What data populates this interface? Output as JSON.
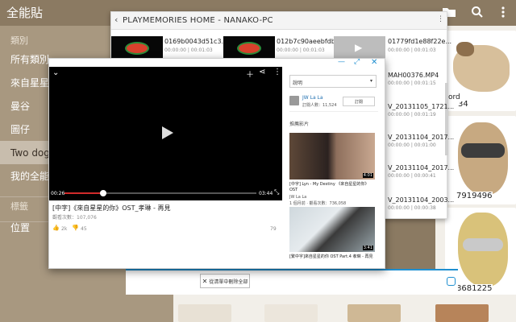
{
  "app": {
    "title": "全能貼"
  },
  "sidebar": {
    "section1": "類別",
    "items": [
      {
        "label": "所有類別"
      },
      {
        "label": "來自星星的"
      },
      {
        "label": "曼谷"
      },
      {
        "label": "圖仔"
      },
      {
        "label": "Two dogs"
      },
      {
        "label": "我的全能貼"
      }
    ],
    "section2": "標籤",
    "section3": "位置"
  },
  "playmemories": {
    "title": "PLAYMEMORIES HOME - NANAKO-PC",
    "top_items": [
      {
        "name": "0169b0043d51c3...",
        "meta": "00:00:00 | 00:01:03"
      },
      {
        "name": "012b7c90aeebfdb...",
        "meta": "00:00:00 | 00:01:03"
      },
      {
        "name": "01779fd1e88f22e...",
        "meta": "00:00:00 | 00:01:03"
      }
    ],
    "list_items": [
      {
        "name": "MAH00376.MP4",
        "meta": "00:00:00 | 00:01:15"
      },
      {
        "name": "V_20131105_1721...",
        "meta": "00:00:00 | 00:01:19"
      },
      {
        "name": "V_20131104_2017...",
        "meta": "00:00:00 | 00:01:00"
      },
      {
        "name": "V_20131104_2017...",
        "meta": "00:00:00 | 00:00:41"
      },
      {
        "name": "V_20131104_2003...",
        "meta": "00:00:00 | 00:00:38"
      }
    ]
  },
  "youtube": {
    "time_current": "00:26",
    "time_total": "03:44",
    "progress": 0.2,
    "title": "[中字]《來自星星的你》OST_孝琳 - 再見",
    "views": "觀看次數：107,076",
    "likes": "2k",
    "dislikes": "45",
    "extra_count": "79",
    "dropdown": "說明",
    "channel": "JW La La",
    "subscribers": "訂閱人數：11,524",
    "subscribe_label": "訂閱",
    "related_header": "推薦影片",
    "related": [
      {
        "duration": "4:01",
        "title": "[中字] Lyn - My Destiny 《來自星星的你》 OST",
        "channel": "JW La La",
        "meta": "1 個月前 · 觀看次數：736,058"
      },
      {
        "duration": "3:41",
        "title": "[繁中字]來自星星的你 OST Part.4 孝琳 - 再見",
        "channel": "",
        "meta": ""
      }
    ]
  },
  "folder": {
    "button_label": "從清單中刪除全部"
  },
  "grid": {
    "labels": [
      "34",
      "7919496",
      "8681225"
    ]
  },
  "partial_label": "ord",
  "colors": {
    "sidebar_bg": "#a89880",
    "accent": "#1f8fd0",
    "app_bar": "#8b7a62",
    "progress": "#d12b2b"
  }
}
